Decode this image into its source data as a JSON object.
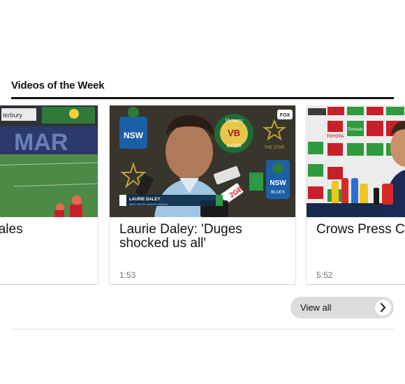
{
  "section": {
    "heading": "Videos of the Week"
  },
  "videos": [
    {
      "title": "wales",
      "duration": ""
    },
    {
      "title": "Laurie Daley: 'Duges shocked us all'",
      "duration": "1:53"
    },
    {
      "title": "Crows Press Co",
      "duration": "5:52"
    }
  ],
  "thumbnail_text": {
    "v1_board": "MAR",
    "v1_top": "terbury",
    "v2_caption_name": "LAURIE DALEY",
    "v2_caption_role": "NEW SOUTH WALES COACH",
    "v2_vb": "VB",
    "v2_victoria": "Victoria",
    "v2_bitter": "BITTER",
    "v2_nsw": "NSW",
    "v2_blues": "BLUES",
    "v2_the_star": "THE STAR",
    "v2_fox": "FOX",
    "v2_mic": "2GB",
    "v3_sponsor": "TOYOTA",
    "v3_domain": "Domain"
  },
  "view_all": {
    "label": "View all"
  }
}
